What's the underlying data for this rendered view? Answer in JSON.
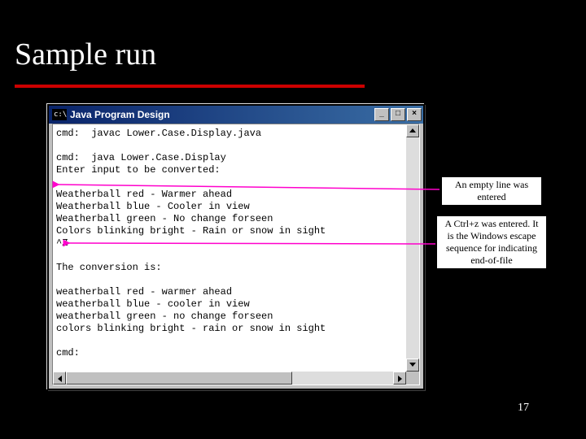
{
  "title": "Sample run",
  "window": {
    "caption": "Java Program Design",
    "icon_text": "c:\\",
    "buttons": {
      "min": "_",
      "max": "□",
      "close": "×"
    }
  },
  "console": {
    "lines": "cmd:  javac Lower.Case.Display.java\n\ncmd:  java Lower.Case.Display\nEnter input to be converted:\n\nWeatherball red - Warmer ahead\nWeatherball blue - Cooler in view\nWeatherball green - No change forseen\nColors blinking bright - Rain or snow in sight\n^Z\n\nThe conversion is:\n\nweatherball red - warmer ahead\nweatherball blue - cooler in view\nweatherball green - no change forseen\ncolors blinking bright - rain or snow in sight\n\ncmd:"
  },
  "callouts": {
    "empty_line": "An empty line was entered",
    "ctrl_z": "A Ctrl+z was entered. It is the Windows escape sequence for indicating end-of-file"
  },
  "page_number": "17"
}
